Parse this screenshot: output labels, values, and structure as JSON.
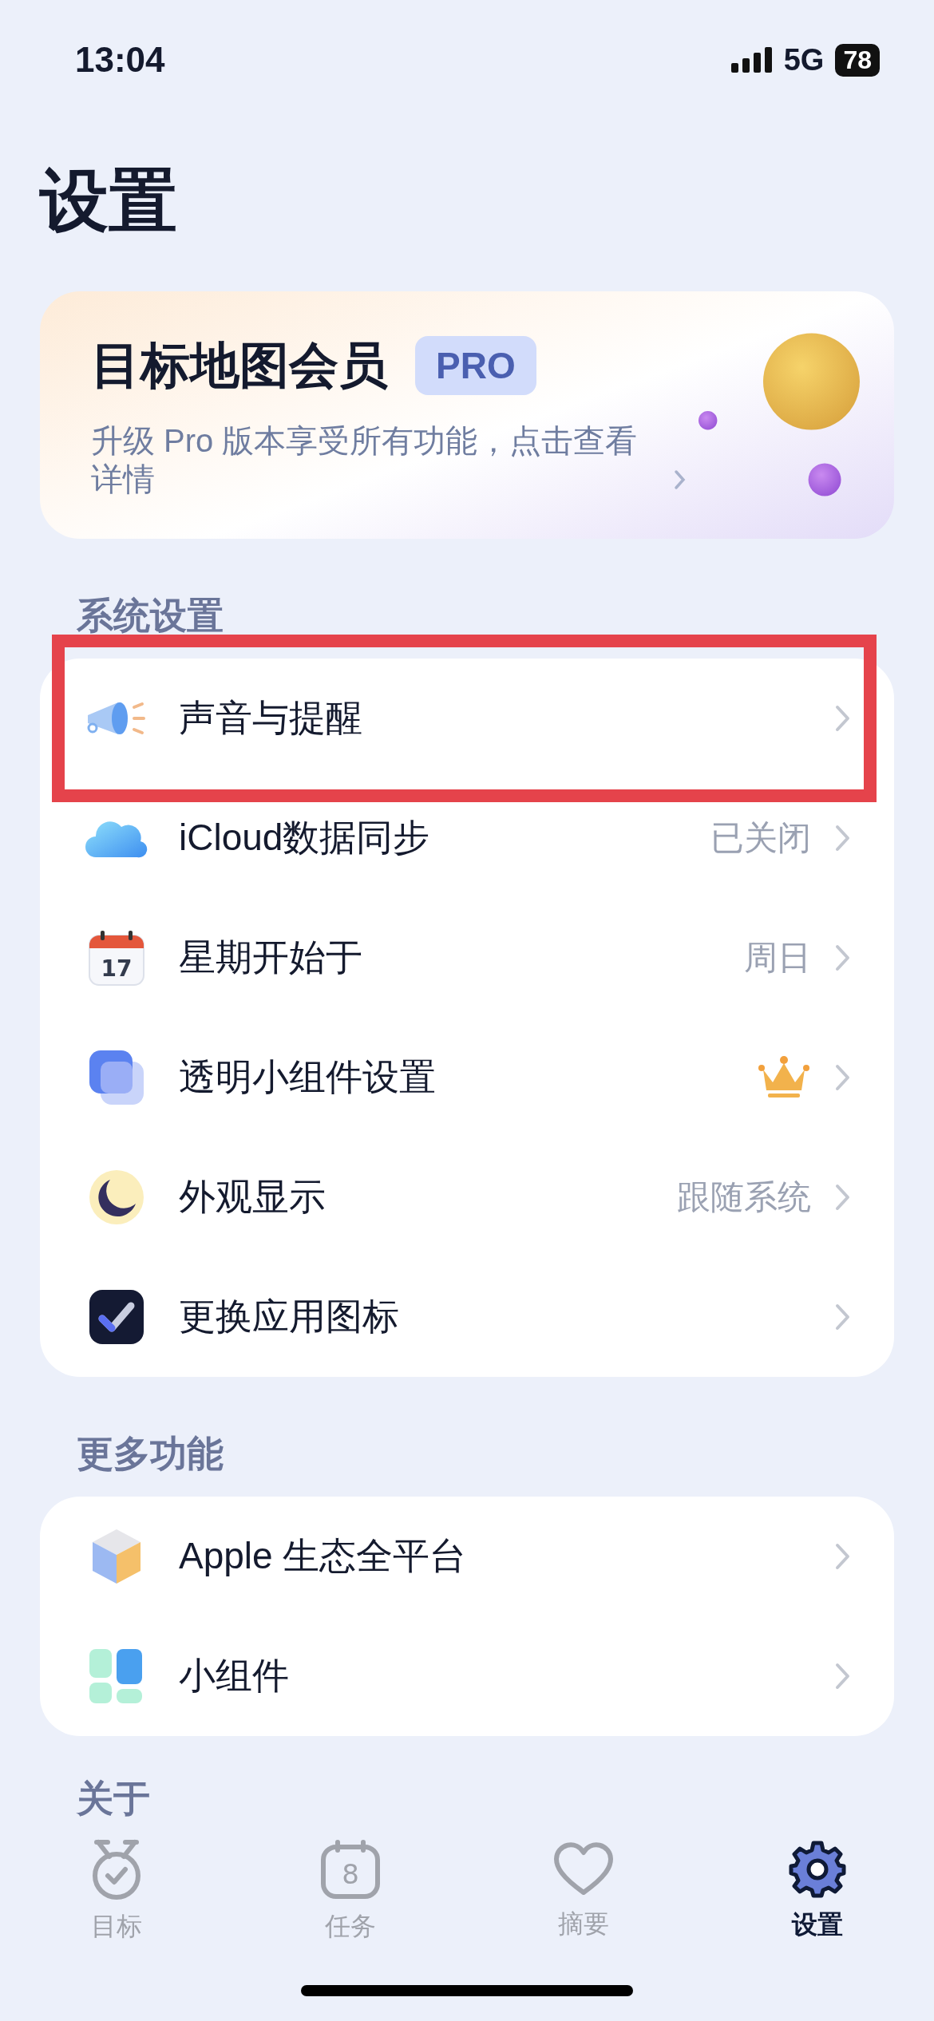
{
  "status_bar": {
    "time": "13:04",
    "network": "5G",
    "battery": "78"
  },
  "title": "设置",
  "pro_card": {
    "title": "目标地图会员",
    "badge": "PRO",
    "description": "升级 Pro 版本享受所有功能，点击查看详情"
  },
  "sections": [
    {
      "header": "系统设置",
      "items": [
        {
          "kind": "sound",
          "label": "声音与提醒",
          "value": null,
          "pro": false,
          "highlighted": true
        },
        {
          "kind": "cloud",
          "label": "iCloud数据同步",
          "value": "已关闭",
          "pro": false,
          "highlighted": false
        },
        {
          "kind": "calendar",
          "icon_text": "17",
          "label": "星期开始于",
          "value": "周日",
          "pro": false,
          "highlighted": false
        },
        {
          "kind": "widget",
          "label": "透明小组件设置",
          "value": null,
          "pro": true,
          "highlighted": false
        },
        {
          "kind": "moon",
          "label": "外观显示",
          "value": "跟随系统",
          "pro": false,
          "highlighted": false
        },
        {
          "kind": "appicon",
          "label": "更换应用图标",
          "value": null,
          "pro": false,
          "highlighted": false
        }
      ]
    },
    {
      "header": "更多功能",
      "items": [
        {
          "kind": "cube",
          "label": "Apple 生态全平台",
          "value": null,
          "pro": false,
          "highlighted": false
        },
        {
          "kind": "tiles",
          "label": "小组件",
          "value": null,
          "pro": false,
          "highlighted": false
        }
      ]
    },
    {
      "header": "关于"
    }
  ],
  "tabs": [
    {
      "kind": "medal",
      "label": "目标",
      "selected": false
    },
    {
      "kind": "calendar",
      "icon_text": "8",
      "label": "任务",
      "selected": false
    },
    {
      "kind": "heart",
      "label": "摘要",
      "selected": false
    },
    {
      "kind": "gear",
      "label": "设置",
      "selected": true
    }
  ]
}
